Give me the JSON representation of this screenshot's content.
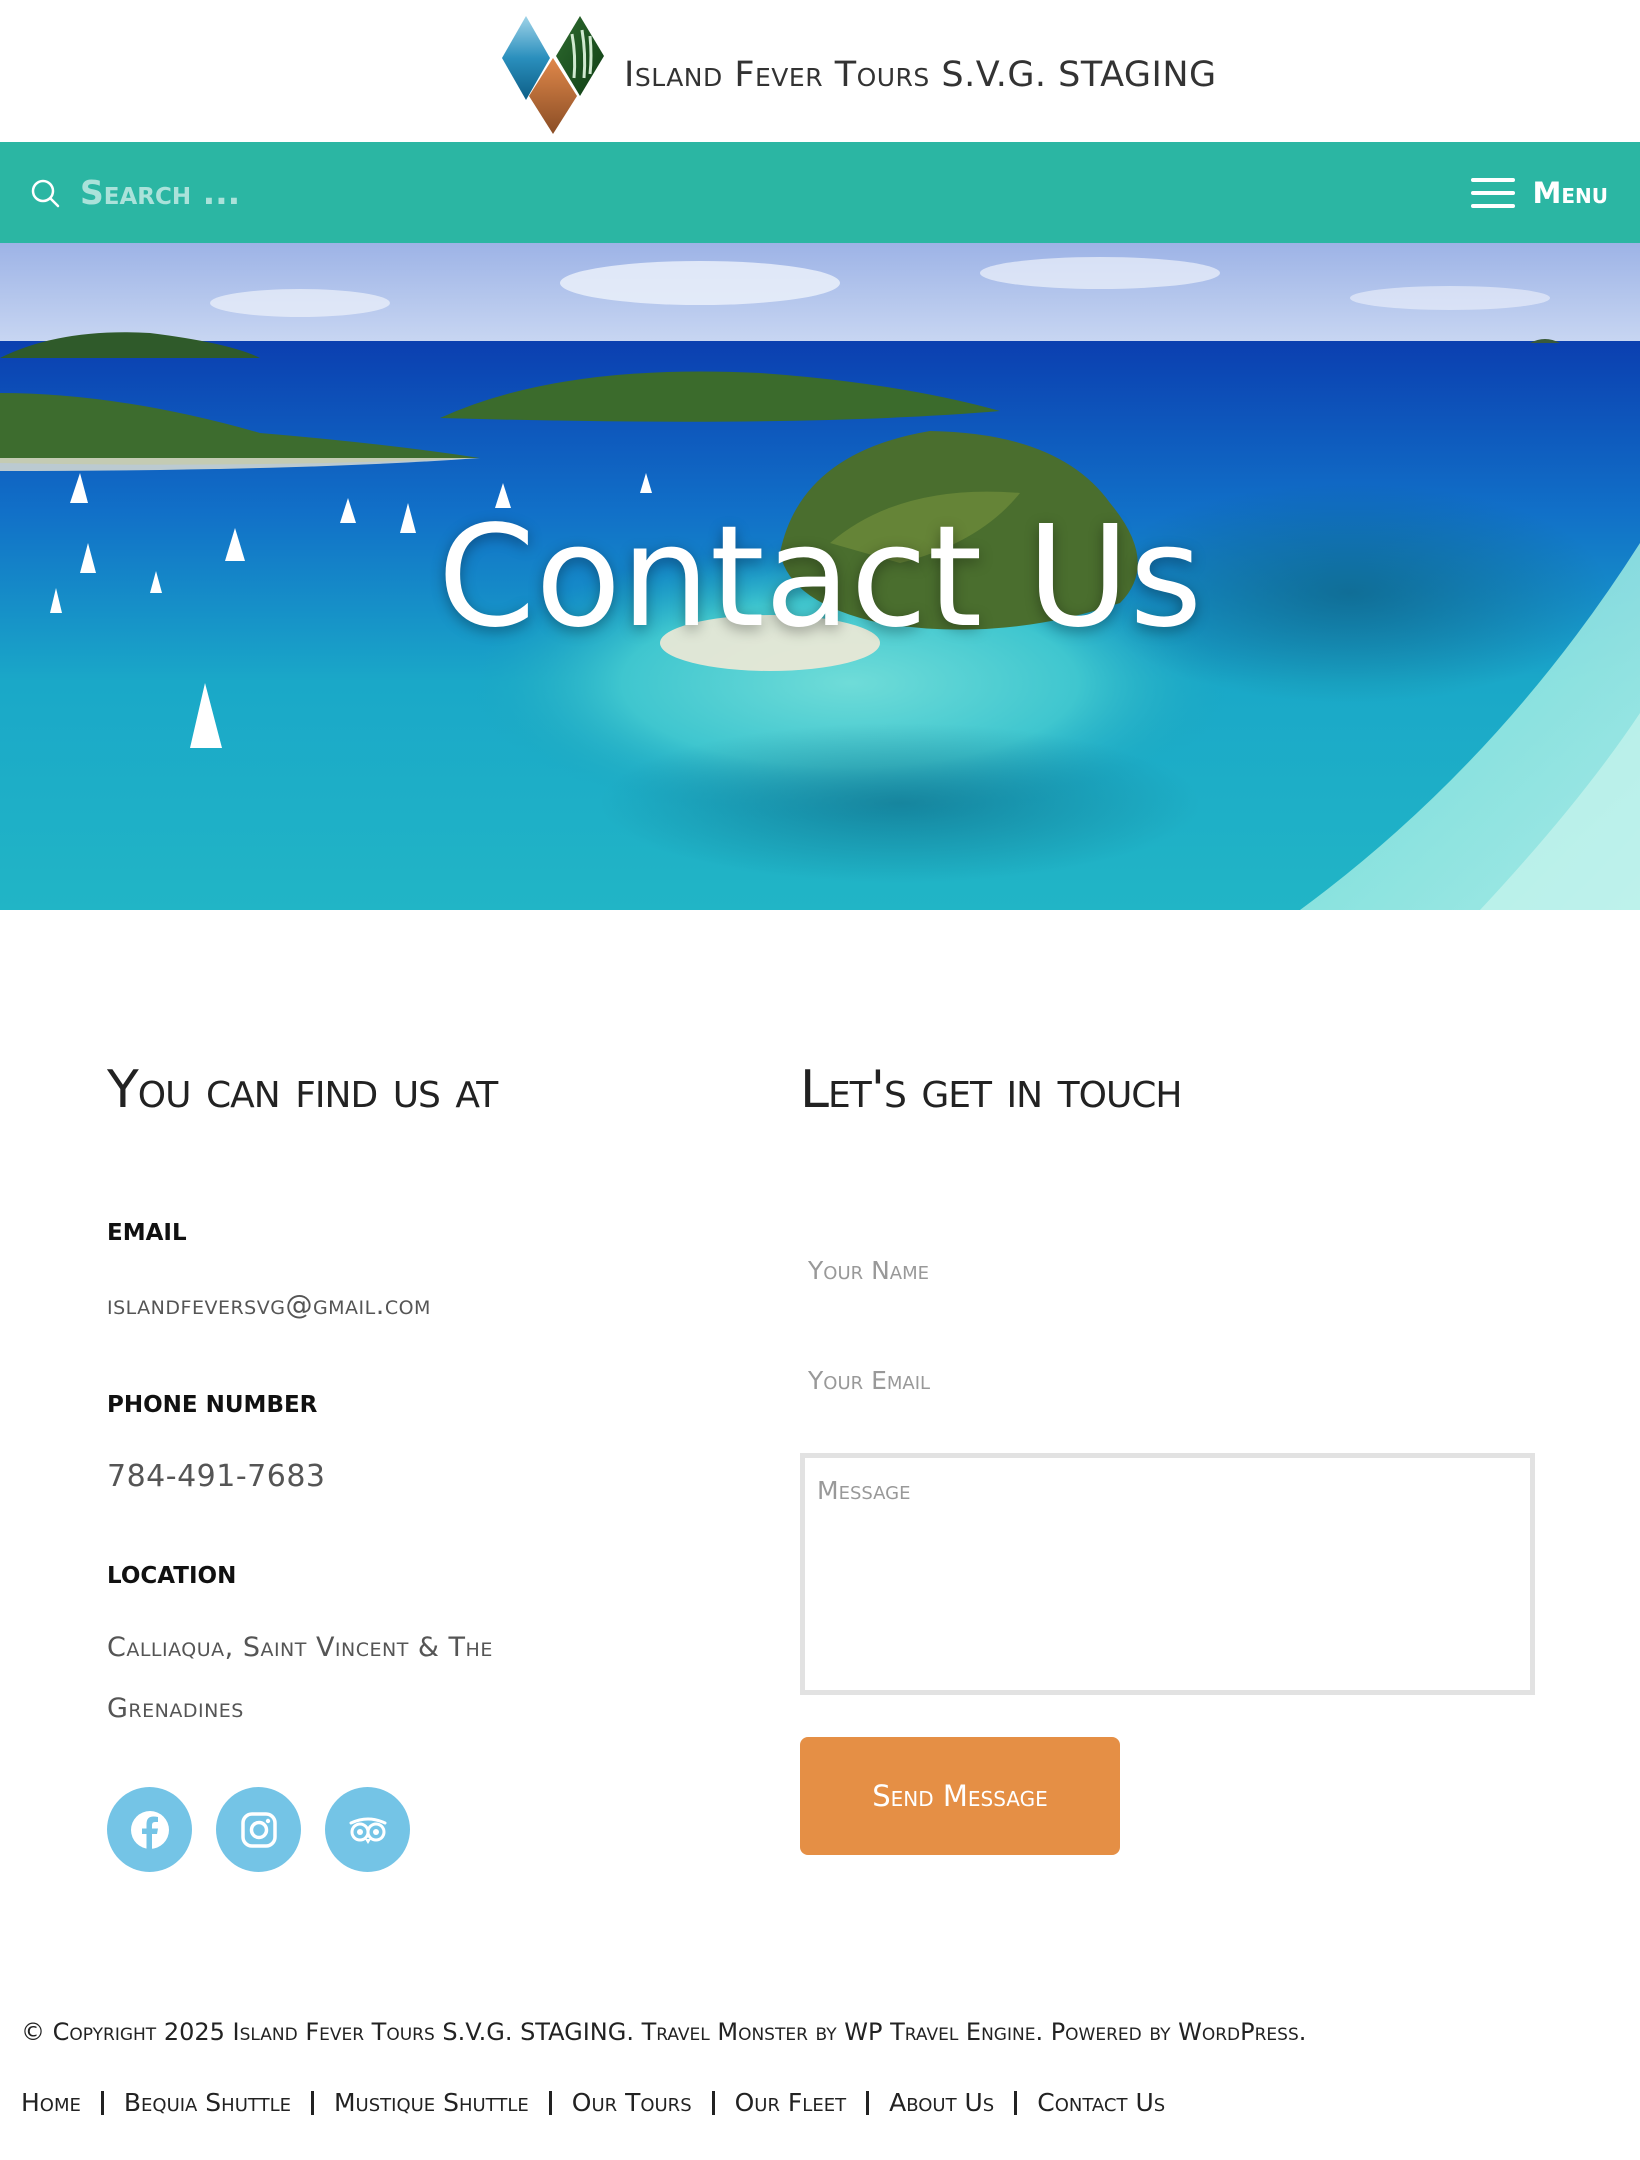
{
  "header": {
    "site_title": "Island Fever Tours S.V.G. STAGING"
  },
  "navbar": {
    "search_placeholder": "Search ...",
    "menu_label": "Menu",
    "accent_color": "#2bb6a3"
  },
  "hero": {
    "title": "Contact Us"
  },
  "contact_info": {
    "heading": "You can find us at",
    "email_label": "EMAIL",
    "email_value": "islandfeversvg@gmail.com",
    "phone_label": "PHONE NUMBER",
    "phone_value": "784-491-7683",
    "location_label": "LOCATION",
    "location_line1": "Calliaqua, Saint Vincent & The",
    "location_line2": "Grenadines",
    "socials": [
      {
        "icon": "facebook-icon"
      },
      {
        "icon": "instagram-icon"
      },
      {
        "icon": "tripadvisor-icon"
      }
    ],
    "social_color": "#74c4e6"
  },
  "contact_form": {
    "heading": "Let's get in touch",
    "name_placeholder": "Your Name",
    "email_placeholder": "Your Email",
    "message_placeholder": "Message",
    "submit_label": "Send Message",
    "submit_color": "#e58f45"
  },
  "footer": {
    "copyright": "© Copyright 2025 Island Fever Tours S.V.G. STAGING. Travel Monster by WP Travel Engine. Powered by WordPress.",
    "links": [
      "Home",
      "Bequia Shuttle",
      "Mustique Shuttle",
      "Our Tours",
      "Our Fleet",
      "About Us",
      "Contact Us"
    ]
  }
}
